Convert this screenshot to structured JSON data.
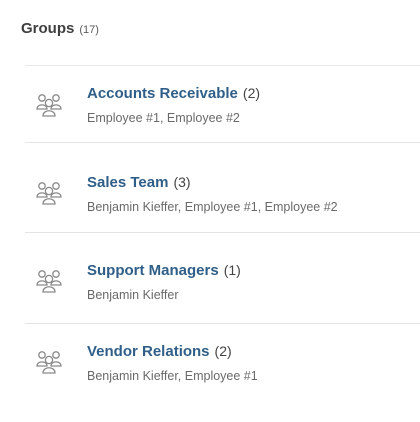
{
  "header": {
    "title": "Groups",
    "count": "(17)"
  },
  "groups": [
    {
      "name": "Accounts Receivable",
      "count": "(2)",
      "members": "Employee #1, Employee #2",
      "icon": "group-icon"
    },
    {
      "name": "Sales Team",
      "count": "(3)",
      "members": "Benjamin Kieffer, Employee #1, Employee #2",
      "icon": "group-icon"
    },
    {
      "name": "Support Managers",
      "count": "(1)",
      "members": "Benjamin Kieffer",
      "icon": "group-icon"
    },
    {
      "name": "Vendor Relations",
      "count": "(2)",
      "members": "Benjamin Kieffer, Employee #1",
      "icon": "group-icon"
    }
  ],
  "colors": {
    "link": "#2f5f88",
    "title": "#3f3f3f",
    "muted": "#6a6a6a",
    "divider": "#e4e4e4"
  }
}
